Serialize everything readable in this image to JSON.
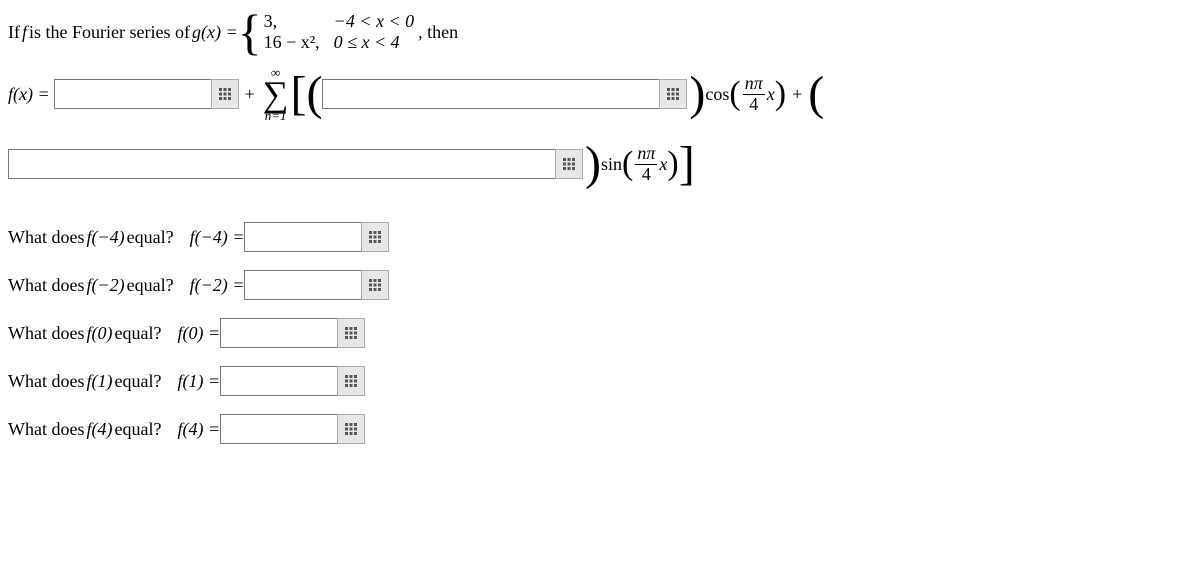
{
  "intro": {
    "pre": "If ",
    "fvar": "f",
    "mid1": " is the Fourier series of ",
    "gx": "g(x) = ",
    "case1a": "3,",
    "case1b": "−4 < x < 0",
    "case2a": "16 − x²,",
    "case2b": "0 ≤ x < 4",
    "then": ", then"
  },
  "eq": {
    "lhs": "f(x) = ",
    "plus": " + ",
    "sum_top": "∞",
    "sum_bot": "n=1",
    "cos": " cos ",
    "sin": " sin ",
    "npi": "nπ",
    "four": "4",
    "x": "x"
  },
  "questions": [
    {
      "text_pre": "What does ",
      "fexpr": "f(−4)",
      "text_post": " equal?",
      "eqlabel": "f(−4) = "
    },
    {
      "text_pre": "What does ",
      "fexpr": "f(−2)",
      "text_post": " equal?",
      "eqlabel": "f(−2) = "
    },
    {
      "text_pre": "What does ",
      "fexpr": "f(0)",
      "text_post": " equal?",
      "eqlabel": "f(0) = "
    },
    {
      "text_pre": "What does ",
      "fexpr": "f(1)",
      "text_post": " equal?",
      "eqlabel": "f(1) = "
    },
    {
      "text_pre": "What does ",
      "fexpr": "f(4)",
      "text_post": " equal?",
      "eqlabel": "f(4) = "
    }
  ],
  "values": {
    "a0": "",
    "an": "",
    "bn": "",
    "fm4": "",
    "fm2": "",
    "f0": "",
    "f1": "",
    "f4": ""
  }
}
